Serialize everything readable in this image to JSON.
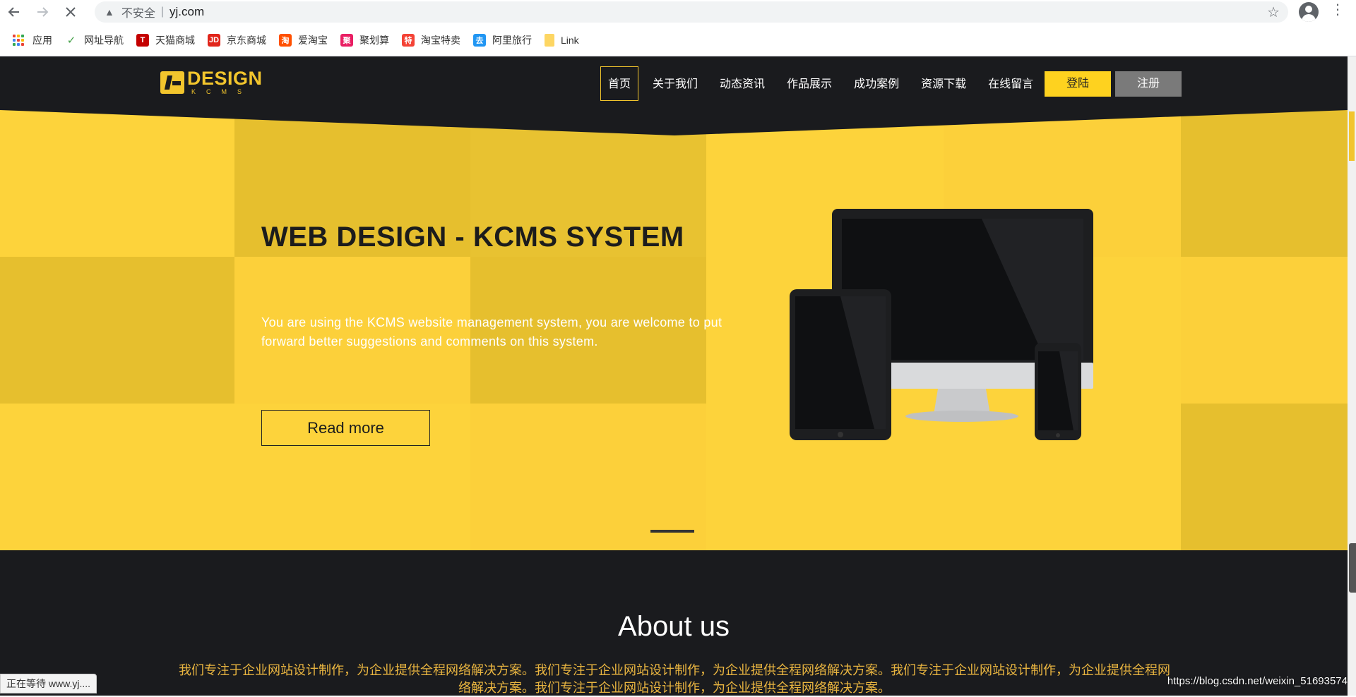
{
  "browser": {
    "security_label": "不安全",
    "separator": "|",
    "url": "yj.com",
    "bookmarks": [
      {
        "label": "应用",
        "icon": "apps-icon"
      },
      {
        "label": "网址导航",
        "icon": "hao-icon",
        "color": "#43a047"
      },
      {
        "label": "天猫商城",
        "icon": "tmall-icon",
        "color": "#c40000",
        "glyph": "T"
      },
      {
        "label": "京东商城",
        "icon": "jd-icon",
        "color": "#e1251b",
        "glyph": "JD"
      },
      {
        "label": "爱淘宝",
        "icon": "aitaobao-icon",
        "color": "#ff5000",
        "glyph": "淘"
      },
      {
        "label": "聚划算",
        "icon": "juhuasuan-icon",
        "color": "#e91e63",
        "glyph": "聚"
      },
      {
        "label": "淘宝特卖",
        "icon": "taobao-temai-icon",
        "color": "#f44336",
        "glyph": "特"
      },
      {
        "label": "阿里旅行",
        "icon": "alitrip-icon",
        "color": "#2196f3",
        "glyph": "去"
      },
      {
        "label": "Link",
        "icon": "folder-icon",
        "color": "#fdd663"
      }
    ]
  },
  "site": {
    "logo": {
      "word": "DESIGN",
      "sub": "KCMS"
    },
    "nav": [
      {
        "label": "首页",
        "active": true
      },
      {
        "label": "关于我们",
        "active": false
      },
      {
        "label": "动态资讯",
        "active": false
      },
      {
        "label": "作品展示",
        "active": false
      },
      {
        "label": "成功案例",
        "active": false
      },
      {
        "label": "资源下载",
        "active": false
      },
      {
        "label": "在线留言",
        "active": false
      }
    ],
    "login_label": "登陆",
    "register_label": "注册",
    "accent_color": "#fed21f",
    "header_bg": "#1a1b1e"
  },
  "hero": {
    "title": "WEB DESIGN - KCMS SYSTEM",
    "description": "You are using the KCMS website management system, you are welcome to put forward better suggestions and comments on this system.",
    "button_label": "Read more"
  },
  "about": {
    "heading": "About us",
    "text": "我们专注于企业网站设计制作，为企业提供全程网络解决方案。我们专注于企业网站设计制作，为企业提供全程网络解决方案。我们专注于企业网站设计制作，为企业提供全程网络解决方案。我们专注于企业网站设计制作，为企业提供全程网络解决方案。"
  },
  "status_bar": "正在等待 www.yj....",
  "watermark": "https://blog.csdn.net/weixin_51693574"
}
